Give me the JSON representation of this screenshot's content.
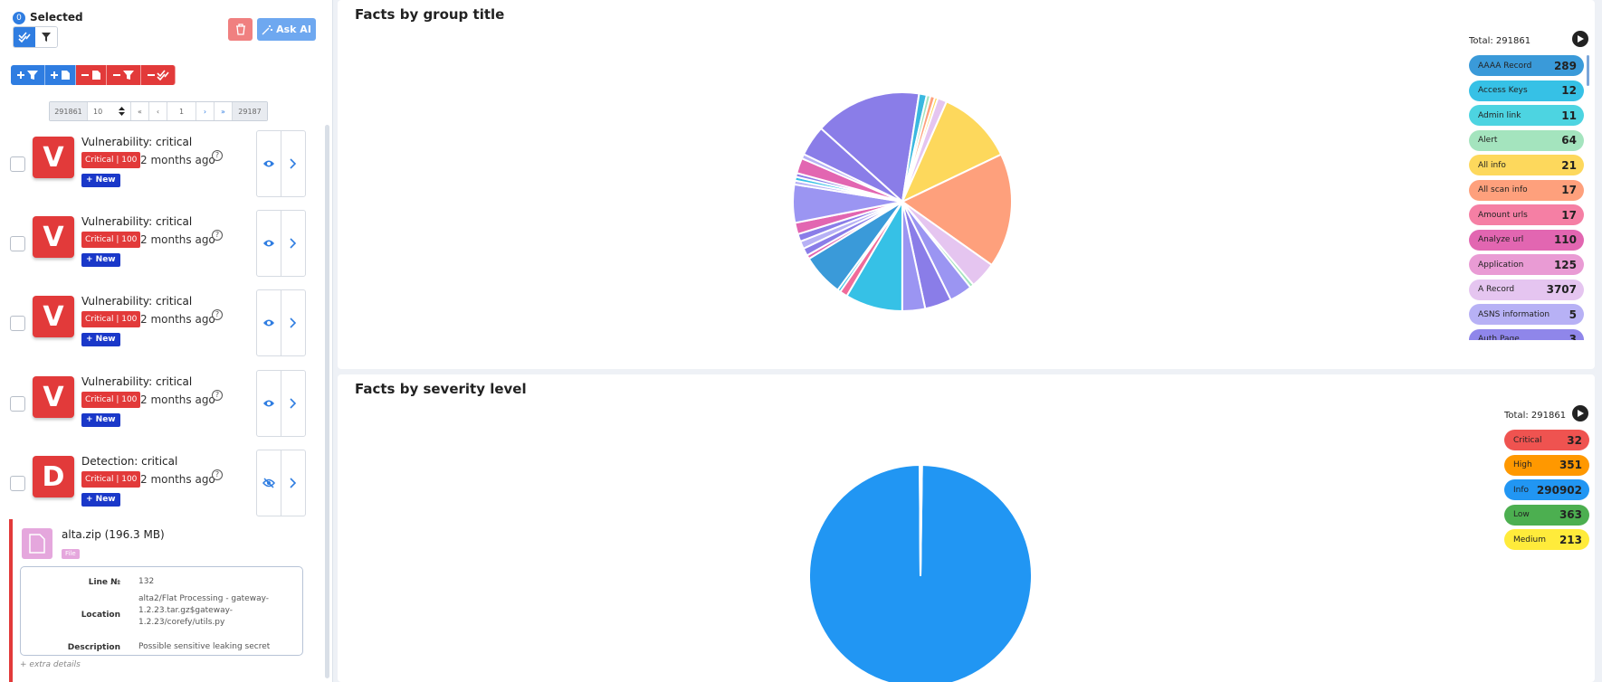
{
  "selection": {
    "count": "0",
    "label": "Selected"
  },
  "toolbar": {
    "ask_ai_label": "Ask AI"
  },
  "pagination": {
    "total": "291861",
    "per_page": "10",
    "first": "«",
    "prev": "‹",
    "page": "1",
    "next": "›",
    "last": "»",
    "pages": "29187"
  },
  "items": [
    {
      "avatar": "V",
      "title": "Vulnerability: critical",
      "badge": "Critical | 100",
      "time": "2 months ago",
      "new_label": "+ New",
      "visible": true
    },
    {
      "avatar": "V",
      "title": "Vulnerability: critical",
      "badge": "Critical | 100",
      "time": "2 months ago",
      "new_label": "+ New",
      "visible": true
    },
    {
      "avatar": "V",
      "title": "Vulnerability: critical",
      "badge": "Critical | 100",
      "time": "2 months ago",
      "new_label": "+ New",
      "visible": true
    },
    {
      "avatar": "V",
      "title": "Vulnerability: critical",
      "badge": "Critical | 100",
      "time": "2 months ago",
      "new_label": "+ New",
      "visible": true
    },
    {
      "avatar": "D",
      "title": "Detection: critical",
      "badge": "Critical | 100",
      "time": "2 months ago",
      "new_label": "+ New",
      "visible": false
    }
  ],
  "file": {
    "name": "alta.zip (196.3 MB)",
    "tag": "File",
    "line_label": "Line №",
    "line_value": "132",
    "location_label": "Location",
    "location_value": "alta2/Flat Processing - gateway-1.2.23.tar.gz$gateway-1.2.23/corefy/utils.py",
    "description_label": "Description",
    "description_value": "Possible sensitive leaking secret",
    "extra": "+ extra details"
  },
  "charts": {
    "group": {
      "title": "Facts by group title",
      "total": "Total: 291861",
      "legend": [
        {
          "label": "AAAA Record",
          "value": "289",
          "color": "#3a9ad9"
        },
        {
          "label": "Access Keys",
          "value": "12",
          "color": "#36c1e6"
        },
        {
          "label": "Admin link",
          "value": "11",
          "color": "#4dd4e1"
        },
        {
          "label": "Alert",
          "value": "64",
          "color": "#a4e4be"
        },
        {
          "label": "All info",
          "value": "21",
          "color": "#fdd85c"
        },
        {
          "label": "All scan info",
          "value": "17",
          "color": "#fea07c"
        },
        {
          "label": "Amount urls",
          "value": "17",
          "color": "#f57fa4"
        },
        {
          "label": "Analyze url",
          "value": "110",
          "color": "#e266b1"
        },
        {
          "label": "Application",
          "value": "125",
          "color": "#e99bd4"
        },
        {
          "label": "A Record",
          "value": "3707",
          "color": "#e5c5f0"
        },
        {
          "label": "ASNS information",
          "value": "5",
          "color": "#b7b1f5"
        },
        {
          "label": "Auth Page",
          "value": "3",
          "color": "#8f86ea"
        }
      ]
    },
    "severity": {
      "title": "Facts by severity level",
      "total": "Total: 291861",
      "legend": [
        {
          "label": "Critical",
          "value": "32",
          "color": "#ef5350"
        },
        {
          "label": "High",
          "value": "351",
          "color": "#ff9800"
        },
        {
          "label": "Info",
          "value": "290902",
          "color": "#2196f3"
        },
        {
          "label": "Low",
          "value": "363",
          "color": "#4caf50"
        },
        {
          "label": "Medium",
          "value": "213",
          "color": "#ffeb3b"
        }
      ]
    }
  },
  "chart_data": [
    {
      "type": "pie",
      "title": "Facts by group title",
      "slices": [
        {
          "color": "#8a7de8",
          "value": 14
        },
        {
          "color": "#3ab8e0",
          "value": 1
        },
        {
          "color": "#a4e4be",
          "value": 0.5
        },
        {
          "color": "#fea07c",
          "value": 0.6
        },
        {
          "color": "#fdd85c",
          "value": 0.4
        },
        {
          "color": "#e5c5f0",
          "value": 1.2
        },
        {
          "color": "#fdd85c",
          "value": 10
        },
        {
          "color": "#fea07c",
          "value": 15
        },
        {
          "color": "#e5c5f0",
          "value": 3.5
        },
        {
          "color": "#a4e4be",
          "value": 0.5
        },
        {
          "color": "#9b95f2",
          "value": 3
        },
        {
          "color": "#8a7de8",
          "value": 3.5
        },
        {
          "color": "#9b95f2",
          "value": 3
        },
        {
          "color": "#36c1e6",
          "value": 7.5
        },
        {
          "color": "#f06b9a",
          "value": 1
        },
        {
          "color": "#36c1e6",
          "value": 0.4
        },
        {
          "color": "#3a9ad9",
          "value": 5.5
        },
        {
          "color": "#e266b1",
          "value": 0.5
        },
        {
          "color": "#8a7de8",
          "value": 1
        },
        {
          "color": "#b7b1f5",
          "value": 1
        },
        {
          "color": "#8a7de8",
          "value": 1
        },
        {
          "color": "#e266b1",
          "value": 1.5
        },
        {
          "color": "#9b95f2",
          "value": 5
        },
        {
          "color": "#b7b1f5",
          "value": 0.5
        },
        {
          "color": "#36c1e6",
          "value": 0.5
        },
        {
          "color": "#8a7de8",
          "value": 0.5
        },
        {
          "color": "#e266b1",
          "value": 2
        },
        {
          "color": "#b7b1f5",
          "value": 0.6
        },
        {
          "color": "#8a7de8",
          "value": 4
        }
      ]
    },
    {
      "type": "pie",
      "title": "Facts by severity level",
      "slices": [
        {
          "label": "Info",
          "value": 290902,
          "color": "#2196f3"
        },
        {
          "label": "Critical",
          "value": 32,
          "color": "#ef5350"
        },
        {
          "label": "High",
          "value": 351,
          "color": "#ff9800"
        },
        {
          "label": "Low",
          "value": 363,
          "color": "#4caf50"
        },
        {
          "label": "Medium",
          "value": 213,
          "color": "#ffeb3b"
        }
      ]
    }
  ]
}
